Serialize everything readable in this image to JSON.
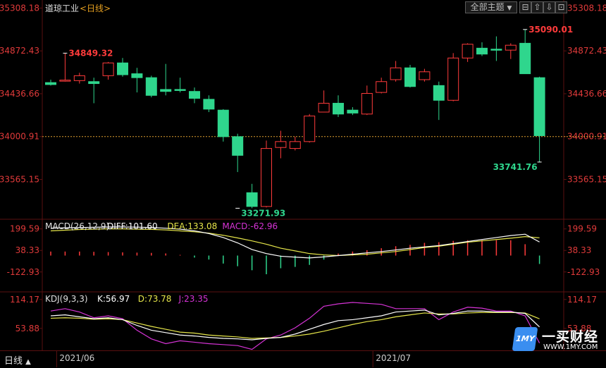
{
  "header": {
    "title": "道琼工业",
    "period_tag": "<日线>",
    "theme_button": "全部主题",
    "theme_arrow": "▼"
  },
  "window_controls": [
    "⊟",
    "⇧",
    "⇩",
    "⊡"
  ],
  "bottom": {
    "period_label": "日线",
    "period_arrow": "▲",
    "x_ticks": [
      {
        "label": "2021/06",
        "index": 1
      },
      {
        "label": "2021/07",
        "index": 23
      }
    ]
  },
  "logo": {
    "mark": "1MY",
    "name": "一买财经",
    "url": "WWW.1MY.COM"
  },
  "colors": {
    "up": "#ff3b3b",
    "down": "#2fd68d",
    "axis_red": "#e03a3a",
    "white": "#ffffff",
    "yellow": "#e6e64a",
    "magenta": "#d633d6",
    "dashed": "#e0a030",
    "grid": "#5a1010"
  },
  "chart_data": [
    {
      "type": "candlestick",
      "name": "道琼工业",
      "y_ticks": [
        35308.18,
        34872.43,
        34436.66,
        34000.91,
        33565.15
      ],
      "ylim": [
        33160,
        35390
      ],
      "reference_price": 34000.91,
      "annotations": [
        {
          "text": "34849.32",
          "index": 1,
          "value": 34849.32,
          "color": "up"
        },
        {
          "text": "33271.93",
          "index": 13,
          "value": 33271.93,
          "color": "down"
        },
        {
          "text": "35090.01",
          "index": 33,
          "value": 35090.01,
          "color": "up"
        },
        {
          "text": "33741.76",
          "index": 34,
          "value": 33741.76,
          "color": "down"
        }
      ],
      "candles": [
        {
          "o": 34550,
          "h": 34580,
          "l": 34520,
          "c": 34530
        },
        {
          "o": 34570,
          "h": 34849.32,
          "l": 34560,
          "c": 34575
        },
        {
          "o": 34570,
          "h": 34650,
          "l": 34540,
          "c": 34620
        },
        {
          "o": 34560,
          "h": 34600,
          "l": 34340,
          "c": 34540
        },
        {
          "o": 34620,
          "h": 34760,
          "l": 34580,
          "c": 34750
        },
        {
          "o": 34750,
          "h": 34800,
          "l": 34610,
          "c": 34630
        },
        {
          "o": 34640,
          "h": 34700,
          "l": 34450,
          "c": 34600
        },
        {
          "o": 34600,
          "h": 34620,
          "l": 34400,
          "c": 34420
        },
        {
          "o": 34480,
          "h": 34740,
          "l": 34420,
          "c": 34460
        },
        {
          "o": 34480,
          "h": 34600,
          "l": 34450,
          "c": 34470
        },
        {
          "o": 34460,
          "h": 34500,
          "l": 34340,
          "c": 34390
        },
        {
          "o": 34380,
          "h": 34420,
          "l": 34250,
          "c": 34280
        },
        {
          "o": 34270,
          "h": 34280,
          "l": 33950,
          "c": 34000
        },
        {
          "o": 34000,
          "h": 34030,
          "l": 33640,
          "c": 33810
        },
        {
          "o": 33430,
          "h": 33520,
          "l": 33271.93,
          "c": 33290
        },
        {
          "o": 33290,
          "h": 33960,
          "l": 33280,
          "c": 33880
        },
        {
          "o": 33890,
          "h": 34060,
          "l": 33780,
          "c": 33950
        },
        {
          "o": 33880,
          "h": 34000,
          "l": 33860,
          "c": 33950
        },
        {
          "o": 33950,
          "h": 34230,
          "l": 33940,
          "c": 34210
        },
        {
          "o": 34250,
          "h": 34470,
          "l": 34250,
          "c": 34340
        },
        {
          "o": 34340,
          "h": 34420,
          "l": 34200,
          "c": 34230
        },
        {
          "o": 34270,
          "h": 34300,
          "l": 34220,
          "c": 34240
        },
        {
          "o": 34230,
          "h": 34520,
          "l": 34220,
          "c": 34440
        },
        {
          "o": 34450,
          "h": 34600,
          "l": 34440,
          "c": 34560
        },
        {
          "o": 34580,
          "h": 34770,
          "l": 34560,
          "c": 34700
        },
        {
          "o": 34700,
          "h": 34730,
          "l": 34500,
          "c": 34510
        },
        {
          "o": 34580,
          "h": 34690,
          "l": 34560,
          "c": 34660
        },
        {
          "o": 34520,
          "h": 34560,
          "l": 34170,
          "c": 34370
        },
        {
          "o": 34370,
          "h": 34850,
          "l": 34360,
          "c": 34800
        },
        {
          "o": 34800,
          "h": 34950,
          "l": 34760,
          "c": 34940
        },
        {
          "o": 34900,
          "h": 34960,
          "l": 34820,
          "c": 34840
        },
        {
          "o": 34890,
          "h": 35020,
          "l": 34770,
          "c": 34880
        },
        {
          "o": 34880,
          "h": 34950,
          "l": 34790,
          "c": 34930
        },
        {
          "o": 34950,
          "h": 35090.01,
          "l": 34660,
          "c": 34640
        },
        {
          "o": 34600,
          "h": 34610,
          "l": 33741.76,
          "c": 34010
        }
      ]
    },
    {
      "type": "macd",
      "label": "MACD(26,12,9)",
      "readouts": [
        {
          "text": "DIFF:101.60",
          "color": "white"
        },
        {
          "text": "DEA:133.08",
          "color": "yellow"
        },
        {
          "text": "MACD:-62.96",
          "color": "magenta"
        }
      ],
      "y_ticks": [
        199.59,
        38.33,
        -122.93
      ],
      "ylim": [
        -272,
        272
      ],
      "diff": [
        205,
        208,
        210,
        212,
        214,
        214,
        213,
        210,
        205,
        198,
        185,
        165,
        135,
        95,
        45,
        15,
        -5,
        -12,
        -18,
        -10,
        0,
        10,
        20,
        30,
        42,
        55,
        65,
        75,
        90,
        105,
        120,
        135,
        150,
        160,
        101.6
      ],
      "dea": [
        185,
        190,
        195,
        198,
        200,
        200,
        198,
        196,
        192,
        185,
        178,
        168,
        152,
        132,
        110,
        85,
        55,
        35,
        15,
        5,
        0,
        5,
        10,
        20,
        30,
        45,
        60,
        70,
        85,
        100,
        110,
        120,
        130,
        142,
        133.08
      ],
      "hist": [
        30,
        30,
        30,
        28,
        26,
        24,
        22,
        20,
        16,
        5,
        -15,
        -30,
        -60,
        -80,
        -110,
        -140,
        -95,
        -85,
        -70,
        -30,
        15,
        30,
        40,
        55,
        70,
        80,
        95,
        100,
        110,
        115,
        115,
        115,
        115,
        85,
        -62.96
      ]
    },
    {
      "type": "kdj",
      "label": "KDJ(9,3,3)",
      "readouts": [
        {
          "text": "K:56.97",
          "color": "white"
        },
        {
          "text": "D:73.78",
          "color": "yellow"
        },
        {
          "text": "J:23.35",
          "color": "magenta"
        }
      ],
      "y_ticks": [
        114.17,
        53.88
      ],
      "ylim": [
        8,
        130
      ],
      "k": [
        80,
        82,
        78,
        74,
        76,
        72,
        60,
        50,
        45,
        40,
        38,
        35,
        33,
        32,
        30,
        33,
        35,
        42,
        52,
        62,
        70,
        72,
        76,
        80,
        88,
        90,
        92,
        82,
        85,
        90,
        90,
        88,
        88,
        85,
        56.97
      ],
      "d": [
        75,
        76,
        75,
        73,
        74,
        72,
        65,
        58,
        52,
        46,
        44,
        40,
        38,
        36,
        33,
        34,
        35,
        38,
        42,
        48,
        55,
        62,
        68,
        72,
        78,
        82,
        86,
        84,
        84,
        86,
        87,
        87,
        87,
        86,
        73.78
      ],
      "j": [
        90,
        95,
        88,
        76,
        80,
        74,
        50,
        32,
        22,
        28,
        25,
        22,
        20,
        18,
        10,
        32,
        40,
        55,
        75,
        100,
        105,
        108,
        106,
        104,
        95,
        95,
        95,
        72,
        88,
        98,
        96,
        90,
        90,
        80,
        23.35
      ]
    }
  ]
}
